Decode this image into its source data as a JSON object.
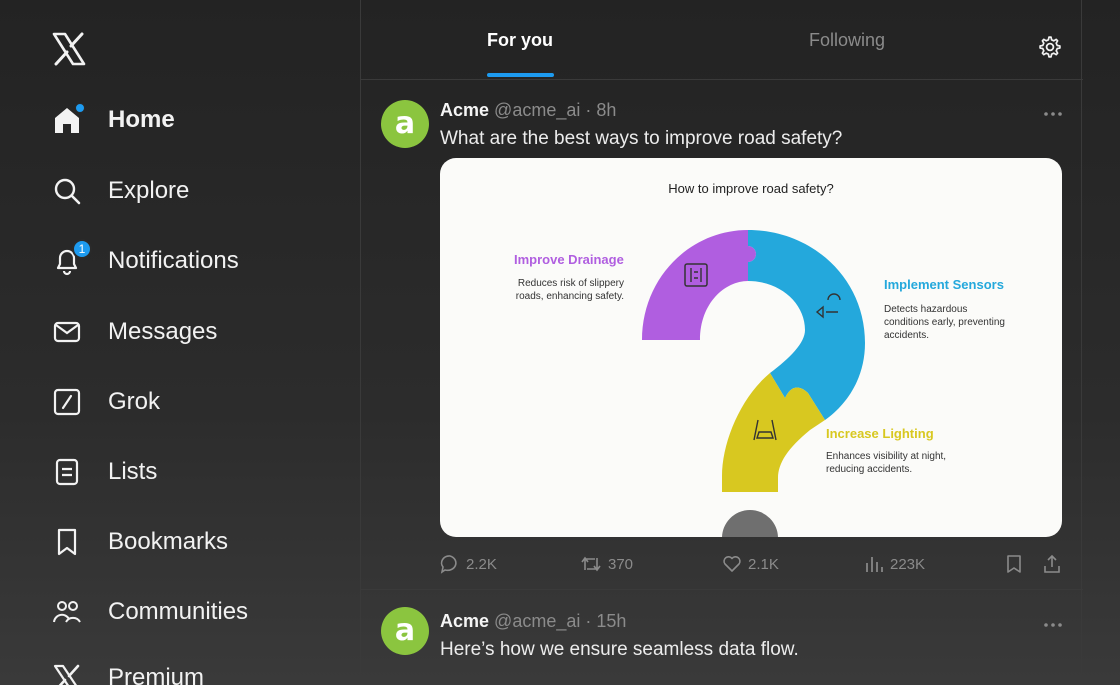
{
  "sidebar": {
    "logo": "x-logo",
    "items": [
      {
        "label": "Home",
        "icon": "home-icon",
        "active": true
      },
      {
        "label": "Explore",
        "icon": "search-icon"
      },
      {
        "label": "Notifications",
        "icon": "bell-icon",
        "badge": "1"
      },
      {
        "label": "Messages",
        "icon": "envelope-icon"
      },
      {
        "label": "Grok",
        "icon": "grok-icon"
      },
      {
        "label": "Lists",
        "icon": "list-icon"
      },
      {
        "label": "Bookmarks",
        "icon": "bookmark-icon"
      },
      {
        "label": "Communities",
        "icon": "people-icon"
      },
      {
        "label": "Premium",
        "icon": "x-icon"
      }
    ]
  },
  "tabs": [
    {
      "label": "For you",
      "active": true
    },
    {
      "label": "Following",
      "active": false
    }
  ],
  "posts": [
    {
      "name": "Acme",
      "handle": "@acme_ai",
      "time": "8h",
      "text": "What are the best ways to improve road safety?",
      "media": {
        "title": "How to improve road safety?",
        "items": [
          {
            "title": "Improve Drainage",
            "desc": [
              "Reduces risk of slippery",
              "roads, enhancing safety."
            ],
            "color": "#b05ee0"
          },
          {
            "title": "Implement Sensors",
            "desc": [
              "Detects hazardous",
              "conditions early, preventing",
              "accidents."
            ],
            "color": "#24a8dc"
          },
          {
            "title": "Increase Lighting",
            "desc": [
              "Enhances visibility at night,",
              "reducing accidents."
            ],
            "color": "#d8c820"
          }
        ]
      },
      "stats": {
        "replies": "2.2K",
        "reposts": "370",
        "likes": "2.1K",
        "views": "223K"
      }
    },
    {
      "name": "Acme",
      "handle": "@acme_ai",
      "time": "15h",
      "text": "Here’s how we ensure seamless data flow."
    }
  ],
  "colors": {
    "accent": "#1d9bf0",
    "avatar": "#8bc53f"
  }
}
